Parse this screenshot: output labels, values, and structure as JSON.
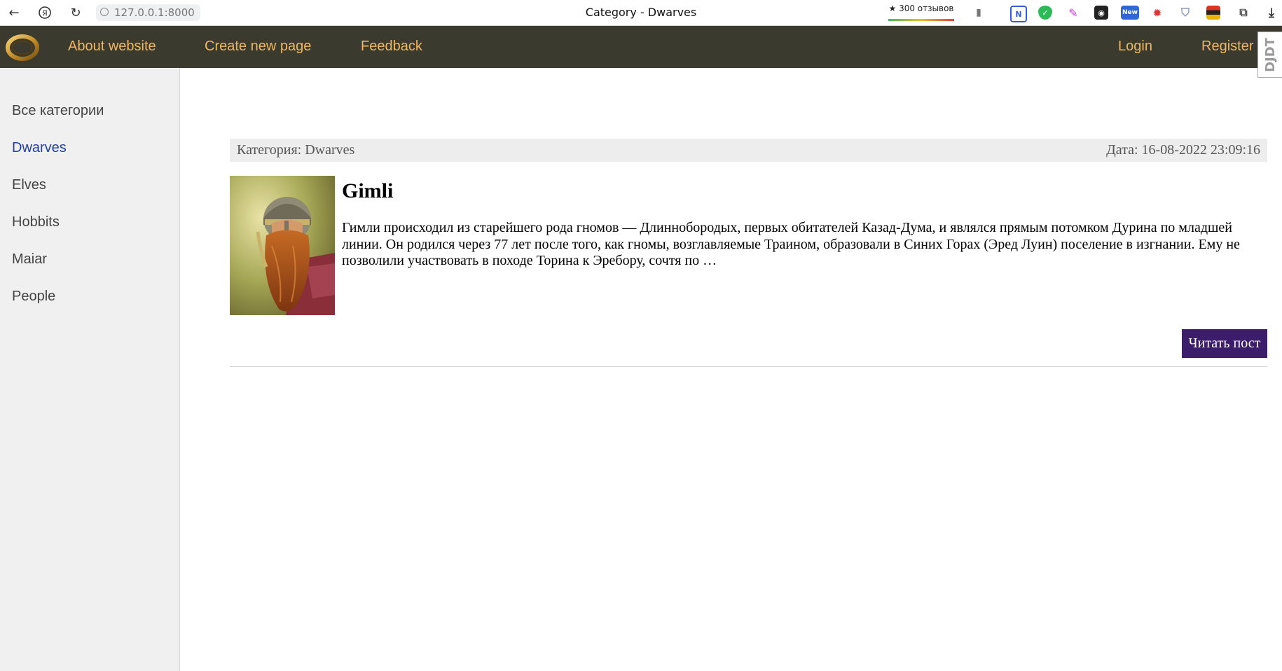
{
  "browser": {
    "url": "127.0.0.1:8000",
    "tab_title": "Category - Dwarves",
    "reviews_badge": "★ 300 отзывов"
  },
  "nav": {
    "about": "About website",
    "create": "Create new page",
    "feedback": "Feedback",
    "login": "Login",
    "register": "Register",
    "djdt": "DJDT"
  },
  "sidebar": {
    "items": [
      {
        "label": "Все категории",
        "active": false
      },
      {
        "label": "Dwarves",
        "active": true
      },
      {
        "label": "Elves",
        "active": false
      },
      {
        "label": "Hobbits",
        "active": false
      },
      {
        "label": "Maiar",
        "active": false
      },
      {
        "label": "People",
        "active": false
      }
    ]
  },
  "post": {
    "category_label": "Категория: Dwarves",
    "date_label": "Дата: 16-08-2022 23:09:16",
    "title": "Gimli",
    "excerpt": "Гимли происходил из старейшего рода гномов — Длиннобородых, первых обитателей Казад-Дума, и являлся прямым потомком Дурина по младшей линии. Он родился через 77 лет после того, как гномы, возглавляемые Траином, образовали в Синих Горах (Эред Луин) поселение в изгнании. Ему не позволили участвовать в походе Торина к Эребору, сочтя по …",
    "read_button": "Читать пост"
  },
  "colors": {
    "header_bg": "#3a3a2f",
    "nav_link": "#f1b75f",
    "active_category": "#2441a8",
    "button_bg": "#3b1d6b"
  }
}
